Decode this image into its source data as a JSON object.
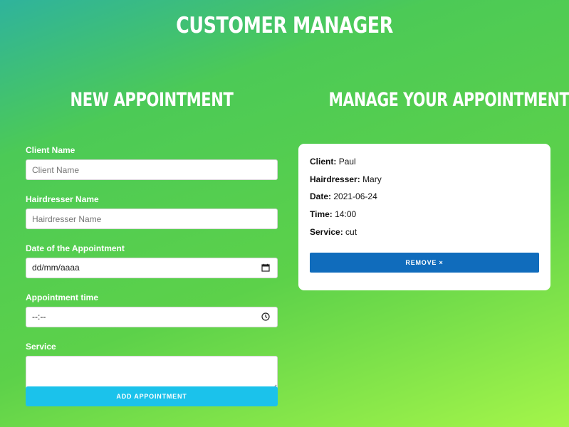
{
  "app": {
    "title": "CUSTOMER MANAGER"
  },
  "new_appointment": {
    "title": "NEW APPOINTMENT",
    "client_label": "Client Name",
    "client_placeholder": "Client Name",
    "client_value": "",
    "hairdresser_label": "Hairdresser Name",
    "hairdresser_placeholder": "Hairdresser Name",
    "hairdresser_value": "",
    "date_label": "Date of the Appointment",
    "date_value": "dd/mm/aaaa",
    "time_label": "Appointment time",
    "time_value": "--:--",
    "service_label": "Service",
    "service_value": "",
    "submit_label": "ADD APPOINTMENT"
  },
  "manage": {
    "title": "MANAGE YOUR APPOINTMENTS",
    "appointments": [
      {
        "client_label": "Client:",
        "client": "Paul",
        "hairdresser_label": "Hairdresser:",
        "hairdresser": "Mary",
        "date_label": "Date:",
        "date": "2021-06-24",
        "time_label": "Time:",
        "time": "14:00",
        "service_label": "Service:",
        "service": "cut",
        "remove_label": "REMOVE ×"
      }
    ]
  },
  "icons": {
    "date_picker": "calendar-icon",
    "time_picker": "clock-icon"
  },
  "colors": {
    "add_button": "#1bc2eb",
    "remove_button": "#106cbc",
    "gradient_start": "#2fb39c",
    "gradient_end": "#a4f54a"
  }
}
